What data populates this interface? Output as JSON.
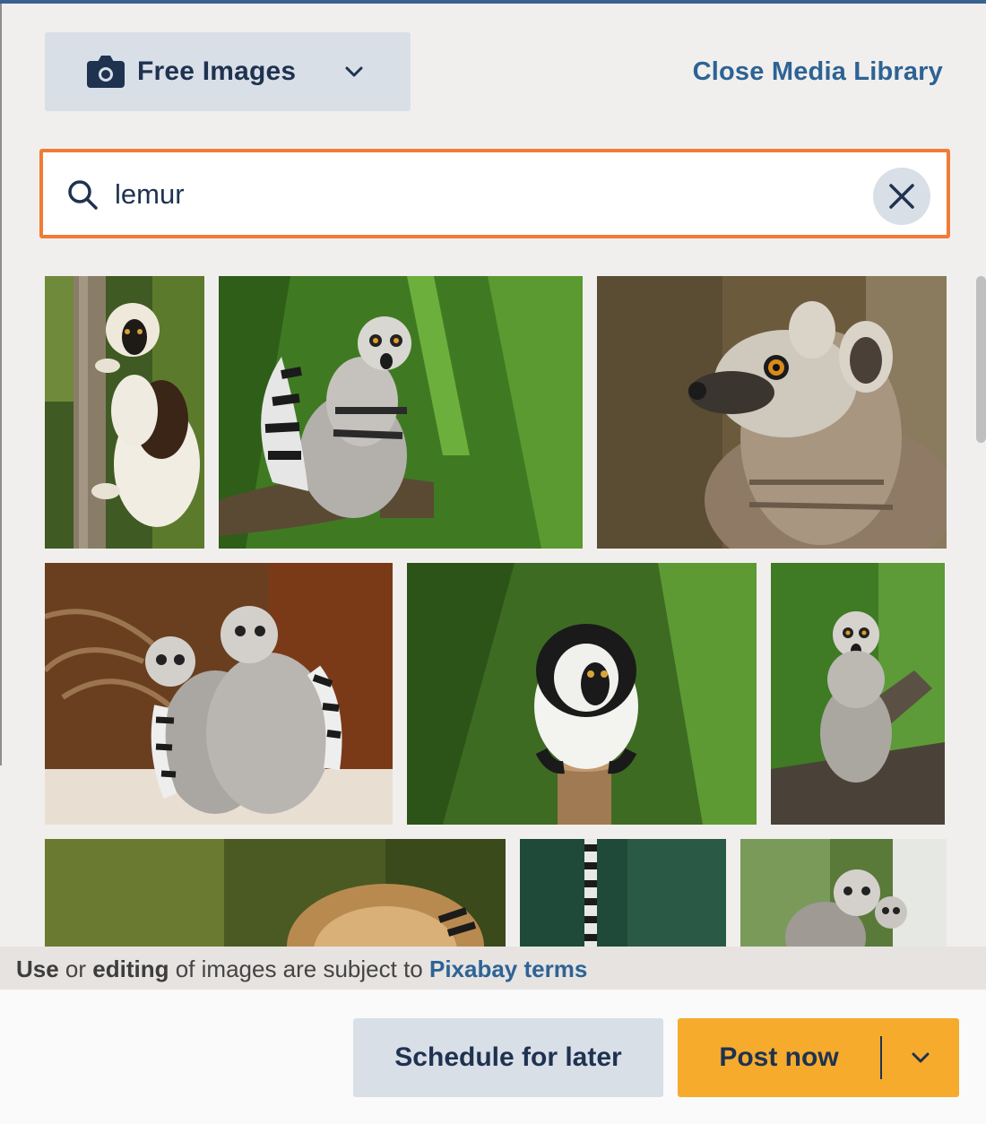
{
  "header": {
    "source_dropdown": {
      "label": "Free Images",
      "icon": "camera-icon",
      "chevron": "chevron-down-icon"
    },
    "close_link": "Close Media Library"
  },
  "search": {
    "value": "lemur",
    "placeholder": "",
    "icon": "search-icon",
    "clear_icon": "close-icon"
  },
  "results": [
    {
      "subject": "sifaka lemur clinging to tree"
    },
    {
      "subject": "ring-tailed lemur on branch in bamboo"
    },
    {
      "subject": "ring-tailed lemur face close-up"
    },
    {
      "subject": "two ring-tailed lemurs sitting"
    },
    {
      "subject": "black-and-white ruffed lemur on post"
    },
    {
      "subject": "ring-tailed lemur on log"
    },
    {
      "subject": "lemur curled up"
    },
    {
      "subject": "lemur tail hanging"
    },
    {
      "subject": "ring-tailed lemurs in tree"
    }
  ],
  "terms": {
    "use": "Use",
    "or": " or ",
    "editing": "editing",
    "rest": " of images are subject to ",
    "link": "Pixabay terms"
  },
  "footer": {
    "schedule_label": "Schedule for later",
    "post_label": "Post now",
    "more_icon": "chevron-down-icon"
  },
  "colors": {
    "accent_orange": "#f07c35",
    "link_blue": "#2d6395",
    "button_gray": "#d9dfe7",
    "post_yellow": "#f6ab2c",
    "text_navy": "#1f3250"
  }
}
